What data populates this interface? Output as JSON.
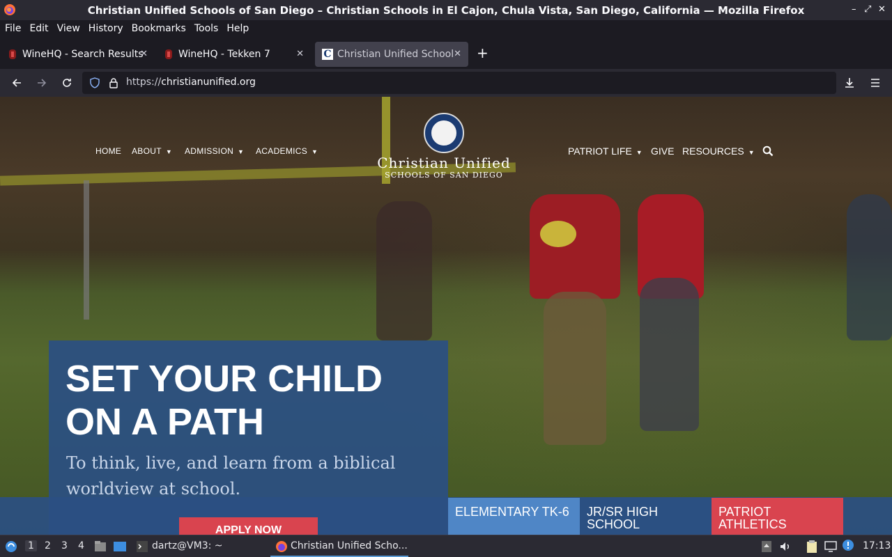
{
  "window": {
    "title": "Christian Unified Schools of San Diego – Christian Schools in El Cajon, Chula Vista, San Diego, California — Mozilla Firefox"
  },
  "menu": [
    "File",
    "Edit",
    "View",
    "History",
    "Bookmarks",
    "Tools",
    "Help"
  ],
  "tabs": [
    {
      "label": "WineHQ - Search Results",
      "active": false
    },
    {
      "label": "WineHQ - Tekken 7",
      "active": false
    },
    {
      "label": "Christian Unified Schools",
      "active": true
    }
  ],
  "address": {
    "protocol": "https://",
    "host": "christianunified.org"
  },
  "site": {
    "nav_left": [
      "HOME",
      "ABOUT",
      "ADMISSION",
      "ACADEMICS"
    ],
    "nav_right": [
      "PATRIOT LIFE",
      "GIVE",
      "RESOURCES"
    ],
    "logo_name": "Christian Unified",
    "logo_sub": "Schools of San Diego",
    "headline": "SET YOUR CHILD ON A PATH",
    "subline": "To think, live, and learn from a biblical worldview at school.",
    "apply_label": "APPLY NOW",
    "categories": [
      {
        "label": "ELEMENTARY TK-6",
        "color": "#4f86c6"
      },
      {
        "label": "JR/SR HIGH SCHOOL",
        "color": "#2b5082"
      },
      {
        "label": "PATRIOT ATHLETICS",
        "color": "#d9444f"
      }
    ]
  },
  "taskbar": {
    "workspaces": [
      "1",
      "2",
      "3",
      "4"
    ],
    "terminal_label": "dartz@VM3: ~",
    "browser_label": "Christian Unified Scho...",
    "clock": "17:13"
  }
}
